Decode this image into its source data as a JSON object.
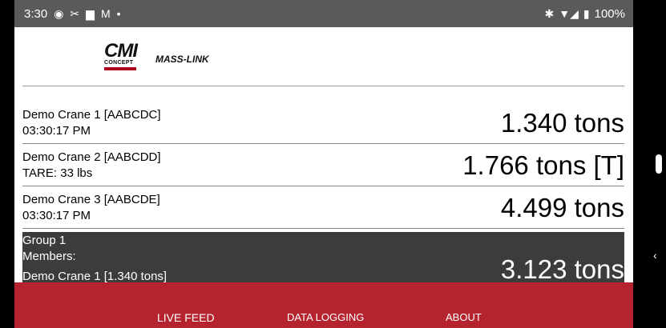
{
  "statusbar": {
    "time": "3:30",
    "left_icons": [
      "◉",
      "✂",
      "▆",
      "M",
      "•"
    ],
    "right_icons": [
      "✱",
      "▼◢",
      "▮"
    ],
    "battery": "100%"
  },
  "logos": {
    "brand_main": "CMI",
    "brand_sub": "CONCEPT",
    "product": "MASS-LINK"
  },
  "rows": [
    {
      "title": "Demo Crane 1 [AABCDC]",
      "sub": "03:30:17 PM",
      "value": "1.340 tons"
    },
    {
      "title": "Demo Crane 2 [AABCDD]",
      "sub": "TARE: 33 lbs",
      "value": "1.766 tons [T]"
    },
    {
      "title": "Demo Crane 3 [AABCDE]",
      "sub": "03:30:17 PM",
      "value": "4.499 tons"
    }
  ],
  "group": {
    "title": "Group 1",
    "sub": "Members:",
    "member": "Demo Crane 1 [1.340 tons]",
    "value": "3.123 tons"
  },
  "nav": {
    "live_feed": "LIVE FEED",
    "data_logging": "DATA LOGGING",
    "about": "ABOUT"
  },
  "colors": {
    "statusbar": "#5a5a5a",
    "nav_bg": "#b5232f",
    "group_bg": "#3c3c3c"
  },
  "sysnav": {
    "back_glyph": "‹"
  }
}
